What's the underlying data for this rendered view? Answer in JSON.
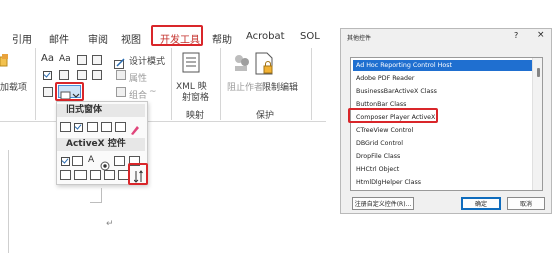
{
  "ribbon": {
    "tabs": [
      "引用",
      "邮件",
      "审阅",
      "视图",
      "开发工具",
      "帮助",
      "Acrobat",
      "SOL"
    ],
    "active_tab": "开发工具",
    "addin_label": "加载项",
    "controls": {
      "design_mode": "设计模式",
      "properties": "属性",
      "group": "组合",
      "group_caret": "~"
    },
    "mapping": {
      "xml_label_line1": "XML 映",
      "xml_label_line2": "射窗格",
      "group_label": "映射"
    },
    "protect": {
      "block_authors": "阻止作者",
      "restrict_editing": "限制编辑",
      "group_label": "保护"
    },
    "aa_large": "Aa",
    "aa_small": "Aa"
  },
  "dropdown": {
    "legacy_header": "旧式窗体",
    "activex_header": "ActiveX 控件",
    "activex_text_a": "A"
  },
  "document": {
    "return_mark": "↵"
  },
  "dialog": {
    "title": "其他控件",
    "help": "?",
    "close": "×",
    "items": [
      "Ad Hoc Reporting Control Host",
      "Adobe PDF Reader",
      "BusinessBarActiveX Class",
      "ButtonBar Class",
      "Composer Player ActiveX",
      "CTreeView Control",
      "DBGrid Control",
      "DropFile Class",
      "HHCtrl Object",
      "HtmlDlgHelper Class"
    ],
    "selected_index": 0,
    "highlighted_item": "Composer Player ActiveX",
    "register_button": "注册自定义控件(R)...",
    "ok_button": "确定",
    "cancel_button": "取消"
  },
  "colors": {
    "accent_red": "#d9262a",
    "selection_blue": "#1f6fd0"
  }
}
